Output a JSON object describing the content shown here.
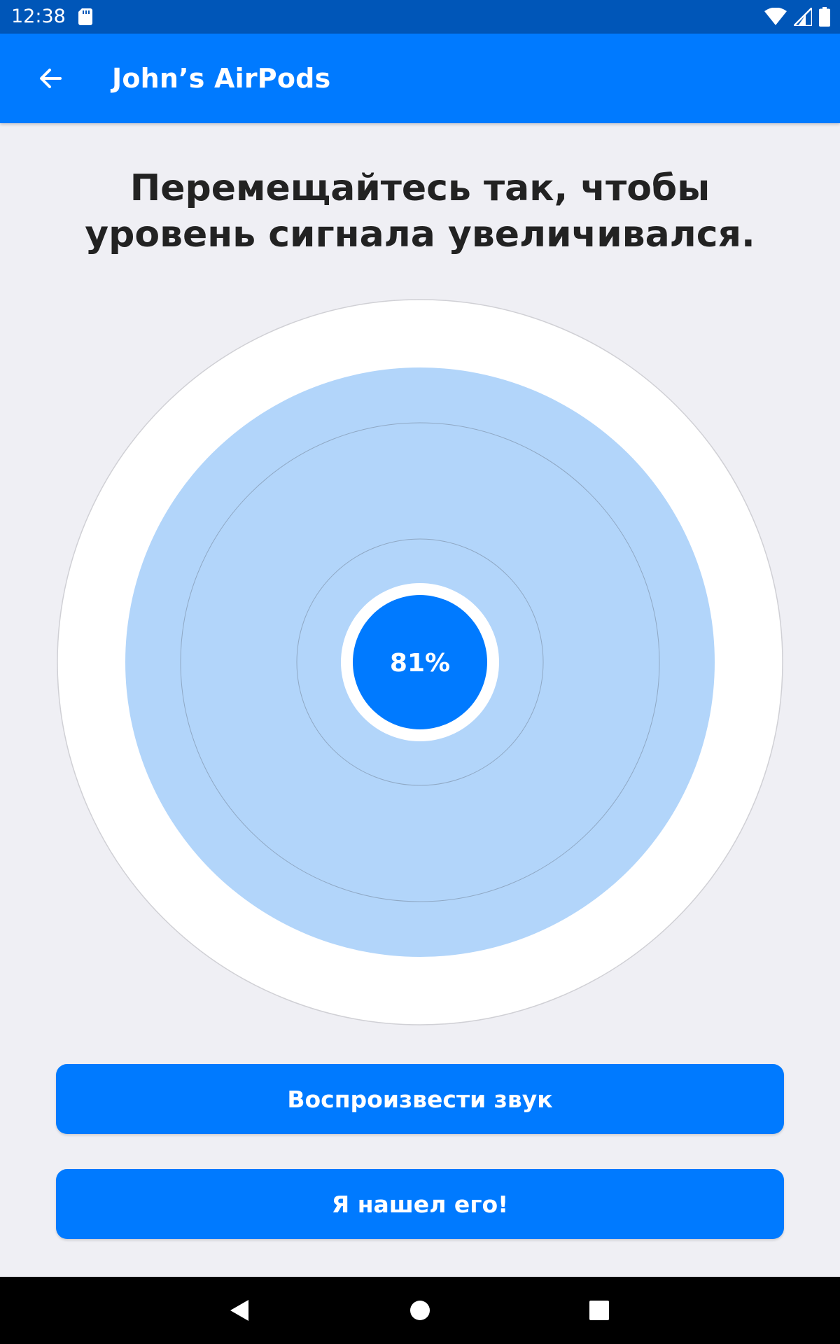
{
  "status_bar": {
    "time": "12:38",
    "icons": [
      "sd-card-icon",
      "wifi-icon",
      "cellular-signal-icon",
      "battery-icon"
    ]
  },
  "app_bar": {
    "back_icon": "arrow-back-icon",
    "title": "John’s AirPods"
  },
  "main": {
    "instruction": "Перемещайтесь так, чтобы уровень сигнала увеличивался.",
    "signal": {
      "percent_label": "81%",
      "level": 0.81
    }
  },
  "buttons": {
    "play_sound": "Воспроизвести звук",
    "found_it": "Я нашел его!"
  },
  "navigation": {
    "items": [
      "back-triangle-icon",
      "home-circle-icon",
      "recents-square-icon"
    ]
  },
  "colors": {
    "accent": "#007aff",
    "status_bar": "#0056b8",
    "radar_fill": "#b2d5fa",
    "background": "#efeff4"
  }
}
